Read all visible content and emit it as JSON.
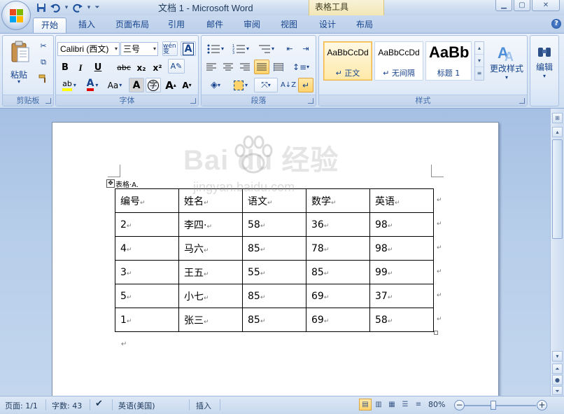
{
  "window": {
    "title": "文档 1 - Microsoft Word",
    "context_tab_label": "表格工具"
  },
  "quick_access": {
    "save_icon": "save-icon",
    "undo_icon": "undo-icon",
    "redo_icon": "redo-icon",
    "customize_icon": "chevron-down-icon"
  },
  "tabs": [
    {
      "label": "开始",
      "active": true
    },
    {
      "label": "插入"
    },
    {
      "label": "页面布局"
    },
    {
      "label": "引用"
    },
    {
      "label": "邮件"
    },
    {
      "label": "审阅"
    },
    {
      "label": "视图"
    },
    {
      "label": "设计"
    },
    {
      "label": "布局"
    }
  ],
  "ribbon": {
    "clipboard": {
      "group_label": "剪贴板",
      "paste_label": "粘贴"
    },
    "font": {
      "group_label": "字体",
      "font_name": "Calibri (西文)",
      "font_size": "三号",
      "bold": "B",
      "italic": "I",
      "underline": "U",
      "strikethrough": "abc",
      "subscript": "x₂",
      "superscript": "x²",
      "change_case": "Aa",
      "char_shading": "A",
      "enclose_char": "字",
      "grow_font": "A",
      "shrink_font": "A",
      "phonetic_guide": "wén 变",
      "char_border": "A",
      "highlight": "ab",
      "font_color": "A"
    },
    "paragraph": {
      "group_label": "段落"
    },
    "styles": {
      "group_label": "样式",
      "items": [
        {
          "sample": "AaBbCcDd",
          "name": "↵ 正文",
          "selected": true
        },
        {
          "sample": "AaBbCcDd",
          "name": "↵ 无间隔"
        },
        {
          "sample": "AaBb",
          "name": "标题 1"
        }
      ],
      "change_styles_label": "更改样式"
    },
    "editing": {
      "label": "编辑"
    }
  },
  "document": {
    "table_caption": "表格·A.",
    "table": [
      [
        "编号",
        "姓名",
        "语文",
        "数学",
        "英语"
      ],
      [
        "2",
        "李四·",
        "58",
        "36",
        "98"
      ],
      [
        "4",
        "马六",
        "85",
        "78",
        "98"
      ],
      [
        "3",
        "王五",
        "55",
        "85",
        "99"
      ],
      [
        "5",
        "小七",
        "85",
        "69",
        "37"
      ],
      [
        "1",
        "张三",
        "85",
        "69",
        "58"
      ]
    ],
    "cell_mark": "↵",
    "watermark": "Bai du 经验",
    "watermark_sub": "jingyan.baidu.com"
  },
  "statusbar": {
    "page": "页面: 1/1",
    "words": "字数: 43",
    "language": "英语(美国)",
    "mode": "插入",
    "zoom": "80%"
  }
}
